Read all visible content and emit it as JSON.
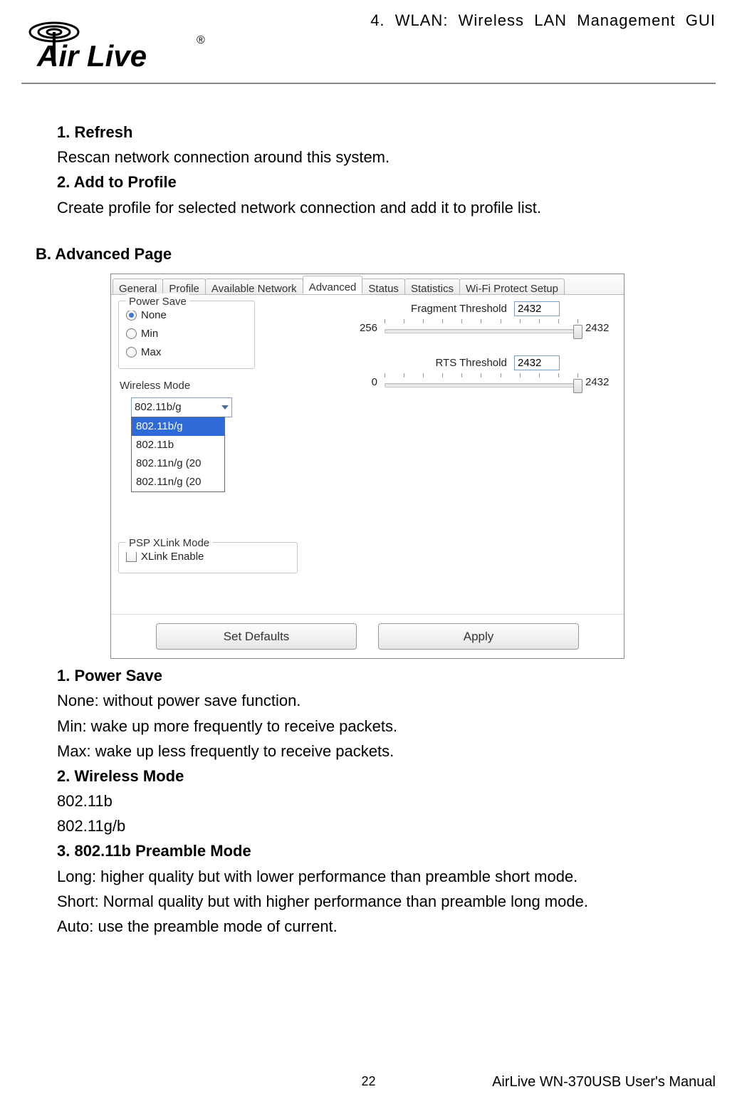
{
  "header": {
    "logo_text": "Air Live",
    "reg_mark": "®",
    "chapter_title": "4.  WLAN:  Wireless  LAN  Management  GUI"
  },
  "body": {
    "item1_heading": "1. Refresh",
    "item1_text": "Rescan network connection around this system.",
    "item2_heading": "2. Add to Profile",
    "item2_text": "Create profile for selected network connection and add it to profile list.",
    "section_b": "B.  Advanced Page",
    "powersave_heading": "1. Power Save",
    "powersave_none": "None: without power save function.",
    "powersave_min": "Min: wake up more frequently to receive packets.",
    "powersave_max": "Max: wake up less frequently to receive packets.",
    "wmode_heading": "2. Wireless Mode",
    "wmode_1": "802.11b",
    "wmode_2": "802.11g/b",
    "preamble_heading": "3. 802.11b Preamble Mode",
    "preamble_long": "Long: higher quality but with lower performance than preamble short mode.",
    "preamble_short": "Short: Normal quality but with higher performance than preamble long mode.",
    "preamble_auto": "Auto: use the preamble mode of current."
  },
  "shot": {
    "tabs": {
      "general": "General",
      "profile": "Profile",
      "available": "Available Network",
      "advanced": "Advanced",
      "status": "Status",
      "statistics": "Statistics",
      "wps": "Wi-Fi Protect Setup"
    },
    "powersave": {
      "legend": "Power Save",
      "none": "None",
      "min": "Min",
      "max": "Max"
    },
    "wireless_mode": {
      "label": "Wireless Mode",
      "selected": "802.11b/g",
      "options": {
        "o1": "802.11b/g",
        "o2": "802.11b",
        "o3": "802.11n/g (20",
        "o4": "802.11n/g (20"
      }
    },
    "xlink": {
      "legend": "PSP XLink Mode",
      "label": "XLink Enable"
    },
    "fragment": {
      "label": "Fragment Threshold",
      "value": "2432",
      "min": "256",
      "max": "2432"
    },
    "rts": {
      "label": "RTS Threshold",
      "value": "2432",
      "min": "0",
      "max": "2432"
    },
    "buttons": {
      "defaults": "Set Defaults",
      "apply": "Apply"
    }
  },
  "footer": {
    "page": "22",
    "manual": "AirLive WN-370USB User's Manual"
  }
}
